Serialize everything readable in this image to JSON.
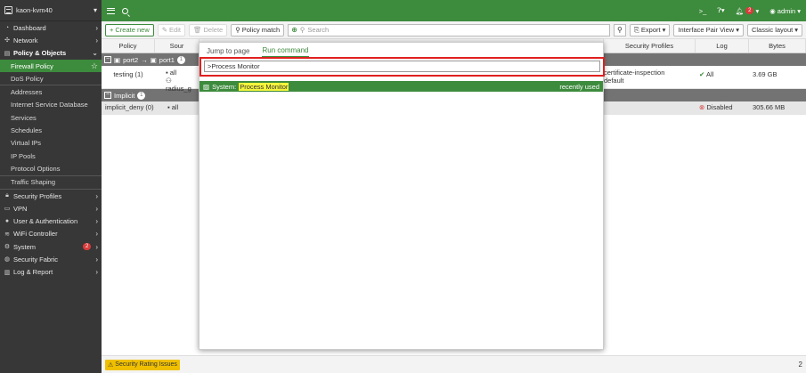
{
  "sidebar": {
    "hostname": "kaon-kvm40",
    "items": [
      {
        "label": "Dashboard",
        "icon": "dashboard-icon"
      },
      {
        "label": "Network",
        "icon": "network-icon"
      },
      {
        "label": "Policy & Objects",
        "icon": "policy-icon"
      },
      {
        "label": "Firewall Policy"
      },
      {
        "label": "DoS Policy"
      },
      {
        "label": "Addresses"
      },
      {
        "label": "Internet Service Database"
      },
      {
        "label": "Services"
      },
      {
        "label": "Schedules"
      },
      {
        "label": "Virtual IPs"
      },
      {
        "label": "IP Pools"
      },
      {
        "label": "Protocol Options"
      },
      {
        "label": "Traffic Shaping"
      },
      {
        "label": "Security Profiles"
      },
      {
        "label": "VPN"
      },
      {
        "label": "User & Authentication"
      },
      {
        "label": "WiFi Controller"
      },
      {
        "label": "System",
        "badge": "2"
      },
      {
        "label": "Security Fabric"
      },
      {
        "label": "Log & Report"
      }
    ]
  },
  "topbar": {
    "notif_count": "2",
    "user": "admin"
  },
  "toolbar": {
    "create_new": "Create new",
    "edit": "Edit",
    "delete": "Delete",
    "policy_match": "Policy match",
    "search_placeholder": "Search",
    "export": "Export",
    "view": "Interface Pair View",
    "layout": "Classic layout"
  },
  "table": {
    "headers": [
      "Policy",
      "Sour",
      "Security Profiles",
      "Log",
      "Bytes"
    ],
    "group1": {
      "from": "port2",
      "to": "port1",
      "count": "1"
    },
    "row1": {
      "policy": "testing (1)",
      "src1": "all",
      "src2": "radius_g",
      "profile1": "certificate-inspection",
      "profile2": "default",
      "log": "All",
      "bytes": "3.69 GB"
    },
    "group2": {
      "label": "Implicit",
      "count": "1"
    },
    "row2": {
      "policy": "implicit_deny (0)",
      "src": "all",
      "log": "Disabled",
      "bytes": "305.66 MB"
    }
  },
  "modal": {
    "tab1": "Jump to page",
    "tab2": "Run command",
    "command_value": ">Process Monitor",
    "result_prefix": "System:",
    "result_match": "Process Monitor",
    "result_hint": "recently used"
  },
  "footer": {
    "rating": "Security Rating Issues",
    "page": "2"
  }
}
